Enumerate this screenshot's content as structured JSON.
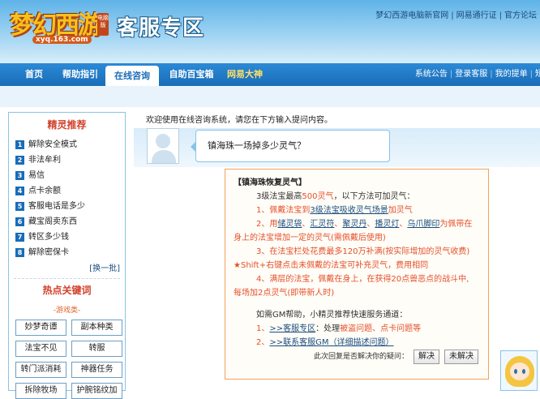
{
  "header": {
    "logo_text": "梦幻西游",
    "logo_badge": "电脑版",
    "logo_url": "xyq.163.com",
    "title": "客服专区",
    "top_links": [
      "梦幻西游电脑新官网",
      "网易通行证",
      "官方论坛"
    ]
  },
  "nav": {
    "items": [
      "首页",
      "帮助指引",
      "在线咨询",
      "自助百宝箱",
      "网易大神"
    ],
    "active": "在线咨询",
    "right_links": [
      "系统公告",
      "登录客服",
      "我的提单",
      "短"
    ]
  },
  "sidebar": {
    "recommend_title": "精灵推荐",
    "recommend_items": [
      {
        "num": "1",
        "label": "解除安全模式"
      },
      {
        "num": "2",
        "label": "非法牟利"
      },
      {
        "num": "3",
        "label": "易信"
      },
      {
        "num": "4",
        "label": "点卡余额"
      },
      {
        "num": "5",
        "label": "客服电话是多少"
      },
      {
        "num": "6",
        "label": "藏宝阁卖东西"
      },
      {
        "num": "7",
        "label": "转区多少钱"
      },
      {
        "num": "8",
        "label": "解除密保卡"
      }
    ],
    "more_label": "[换一批]",
    "hot_title": "热点关键词",
    "hot_sub": "-游戏类-",
    "keywords": [
      "妙梦奇谭",
      "副本种类",
      "法宝不见",
      "转服",
      "转门派消耗",
      "神器任务",
      "拆除牧场",
      "护腕铭纹加"
    ]
  },
  "chat": {
    "welcome": "欢迎使用在线咨询系统，请您在下方输入提问内容。",
    "question": "镇海珠一场掉多少灵气？",
    "answer": {
      "title": "【镇海珠恢复灵气】",
      "line1_a": "3级法宝最高",
      "line1_b": "500灵气",
      "line1_c": "，以下方法可加灵气：",
      "line2_a": "1、佩戴法宝到",
      "line2_b": "3级法宝吸收灵气场景",
      "line2_c": "加灵气",
      "line3_a": "2、用",
      "line3_b1": "储灵袋",
      "line3_sep1": "、",
      "line3_b2": "汇灵符",
      "line3_sep2": "、",
      "line3_b3": "聚灵丹",
      "line3_sep3": "、",
      "line3_b4": "播灵灯",
      "line3_sep4": "、",
      "line3_b5": "乌爪脚印",
      "line3_c": "为佩带在",
      "line4": "身上的法宝增加一定的灵气(需佩戴后使用)",
      "line5": "3、在法宝栏处花费最多120万补满(按实际增加的灵气收费)",
      "line6": "★Shift+右键点击未佩戴的法宝可补充灵气，费用相同",
      "line7": "4、满层的法宝，佩戴在身上，在获得20点兽恶点的战斗中,",
      "line8": "每场加2点灵气(即带新人时)",
      "gm_intro": "如需GM帮助，小精灵推荐快速服务通道：",
      "gm1_a": "1、",
      "gm1_link": ">>客服专区",
      "gm1_b": "：处理",
      "gm1_c": "被盗问题、点卡问题等",
      "gm2_a": "2、",
      "gm2_link": ">>联系客服GM（详细描述问题）"
    },
    "feedback_prompt": "此次回复是否解决你的疑问：",
    "solved_button": "解决",
    "unsolved_button": "未解决"
  }
}
